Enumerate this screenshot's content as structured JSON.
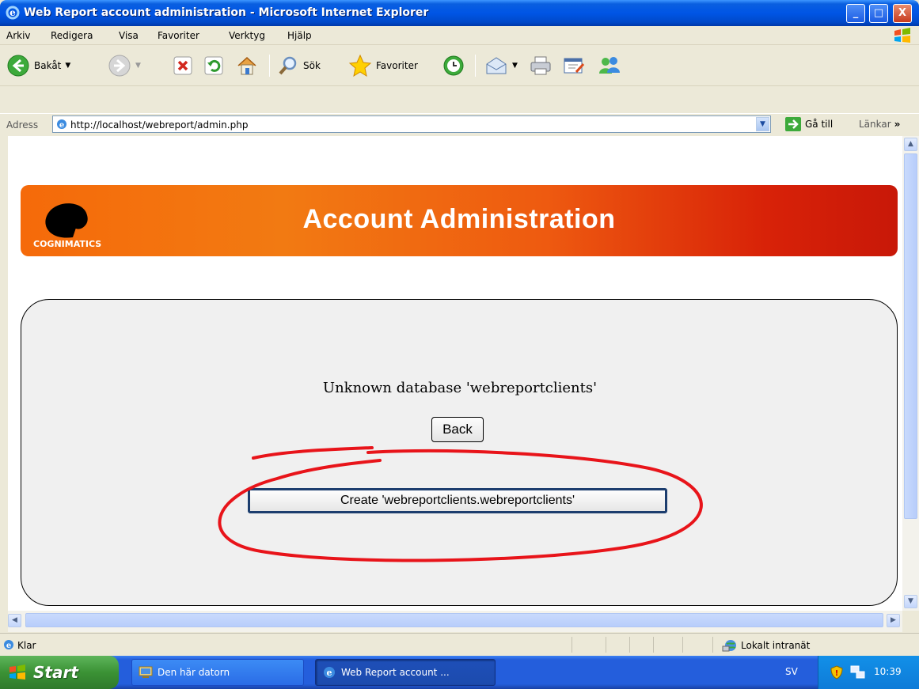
{
  "window": {
    "title": "Web Report account administration - Microsoft Internet Explorer",
    "minimize": "_",
    "maximize": "□",
    "close": "X"
  },
  "menu": {
    "items": [
      "Arkiv",
      "Redigera",
      "Visa",
      "Favoriter",
      "Verktyg",
      "Hjälp"
    ]
  },
  "toolbar": {
    "back_label": "Bakåt",
    "search_label": "Sök",
    "favorites_label": "Favoriter"
  },
  "address": {
    "label": "Adress",
    "url": "http://localhost/webreport/admin.php",
    "go_label": "Gå till",
    "links_label": "Länkar",
    "links_more": "»"
  },
  "page": {
    "brand": "COGNIMATICS",
    "heading": "Account Administration",
    "message": "Unknown database 'webreportclients'",
    "back_button": "Back",
    "create_button": "Create 'webreportclients.webreportclients'"
  },
  "status": {
    "text": "Klar",
    "zone": "Lokalt intranät"
  },
  "taskbar": {
    "start": "Start",
    "tasks": [
      "Den här datorn",
      "Web Report account ..."
    ],
    "language": "SV",
    "clock": "10:39"
  },
  "colors": {
    "banner_start": "#F56A0A",
    "banner_end": "#C81808",
    "highlight_circle": "#E8141A"
  }
}
